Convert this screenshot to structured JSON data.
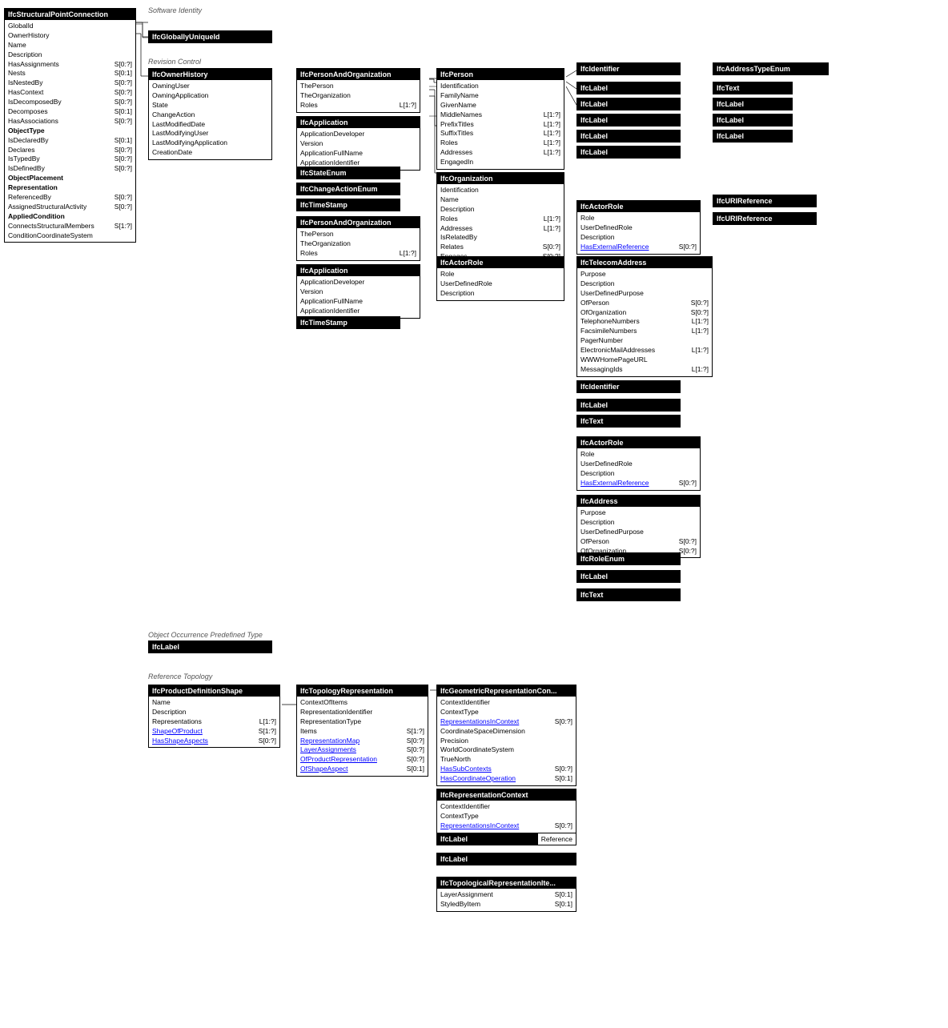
{
  "sections": {
    "softwareIdentity": "Software Identity",
    "revisionControl": "Revision Control",
    "objectOccurrencePredefinedType": "Object Occurrence Predefined Type",
    "referenceTopology": "Reference Topology"
  },
  "boxes": {
    "ifcStructuralPointConnection": {
      "header": "IfcStructuralPointConnection",
      "attrs": [
        {
          "name": "GlobalId",
          "type": ""
        },
        {
          "name": "OwnerHistory",
          "type": ""
        },
        {
          "name": "Name",
          "type": ""
        },
        {
          "name": "Description",
          "type": ""
        },
        {
          "name": "HasAssignments",
          "type": "S[0:?]"
        },
        {
          "name": "Nests",
          "type": "S[0:1]"
        },
        {
          "name": "IsNestedBy",
          "type": "S[0:?]"
        },
        {
          "name": "HasContext",
          "type": "S[0:?]"
        },
        {
          "name": "IsDecomposedBy",
          "type": "S[0:?]"
        },
        {
          "name": "Decomposes",
          "type": "S[0:1]"
        },
        {
          "name": "HasAssociations",
          "type": "S[0:?]"
        },
        {
          "name": "ObjectType",
          "type": "",
          "bold": true
        },
        {
          "name": "IsDeclaredBy",
          "type": "S[0:1]"
        },
        {
          "name": "Declares",
          "type": "S[0:?]"
        },
        {
          "name": "IsTypedBy",
          "type": "S[0:?]"
        },
        {
          "name": "IsDefinedBy",
          "type": "S[0:?]"
        },
        {
          "name": "ObjectPlacement",
          "type": "",
          "bold": true
        },
        {
          "name": "Representation",
          "type": "",
          "bold": true
        },
        {
          "name": "ReferencedBy",
          "type": "S[0:?]"
        },
        {
          "name": "AssignedStructuralActivity",
          "type": "S[0:?]"
        },
        {
          "name": "AppliedCondition",
          "type": "",
          "bold": true
        },
        {
          "name": "ConnectsStructuralMembers",
          "type": "S[1:?]"
        },
        {
          "name": "ConditionCoordinateSystem",
          "type": ""
        }
      ]
    },
    "ifcGloballyUniqueId": {
      "header": "IfcGloballyUniqueId",
      "attrs": []
    },
    "ifcOwnerHistory": {
      "header": "IfcOwnerHistory",
      "attrs": [
        {
          "name": "OwningUser",
          "type": ""
        },
        {
          "name": "OwningApplication",
          "type": ""
        },
        {
          "name": "State",
          "type": ""
        },
        {
          "name": "ChangeAction",
          "type": ""
        },
        {
          "name": "LastModifiedDate",
          "type": ""
        },
        {
          "name": "LastModifyingUser",
          "type": ""
        },
        {
          "name": "LastModifyingApplication",
          "type": ""
        },
        {
          "name": "CreationDate",
          "type": ""
        }
      ]
    },
    "ifcPersonAndOrganization1": {
      "header": "IfcPersonAndOrganization",
      "attrs": [
        {
          "name": "ThePerson",
          "type": ""
        },
        {
          "name": "TheOrganization",
          "type": ""
        },
        {
          "name": "Roles",
          "type": "L[1:?]"
        }
      ]
    },
    "ifcApplication1": {
      "header": "IfcApplication",
      "attrs": [
        {
          "name": "ApplicationDeveloper",
          "type": ""
        },
        {
          "name": "Version",
          "type": ""
        },
        {
          "name": "ApplicationFullName",
          "type": ""
        },
        {
          "name": "ApplicationIdentifier",
          "type": ""
        }
      ]
    },
    "ifcStateEnum": {
      "header": "IfcStateEnum",
      "attrs": []
    },
    "ifcChangeActionEnum": {
      "header": "IfcChangeActionEnum",
      "attrs": []
    },
    "ifcTimeStamp1": {
      "header": "IfcTimeStamp",
      "attrs": []
    },
    "ifcPersonAndOrganization2": {
      "header": "IfcPersonAndOrganization",
      "attrs": [
        {
          "name": "ThePerson",
          "type": ""
        },
        {
          "name": "TheOrganization",
          "type": ""
        },
        {
          "name": "Roles",
          "type": "L[1:?]"
        }
      ]
    },
    "ifcApplication2": {
      "header": "IfcApplication",
      "attrs": [
        {
          "name": "ApplicationDeveloper",
          "type": ""
        },
        {
          "name": "Version",
          "type": ""
        },
        {
          "name": "ApplicationFullName",
          "type": ""
        },
        {
          "name": "ApplicationIdentifier",
          "type": ""
        }
      ]
    },
    "ifcTimeStamp2": {
      "header": "IfcTimeStamp",
      "attrs": []
    },
    "ifcPerson": {
      "header": "IfcPerson",
      "attrs": [
        {
          "name": "Identification",
          "type": ""
        },
        {
          "name": "FamilyName",
          "type": ""
        },
        {
          "name": "GivenName",
          "type": ""
        },
        {
          "name": "MiddleNames",
          "type": "L[1:?]"
        },
        {
          "name": "PrefixTitles",
          "type": "L[1:?]"
        },
        {
          "name": "SuffixTitles",
          "type": "L[1:?]"
        },
        {
          "name": "Roles",
          "type": "L[1:?]"
        },
        {
          "name": "Addresses",
          "type": "L[1:?]"
        },
        {
          "name": "EngagedIn",
          "type": ""
        }
      ]
    },
    "ifcOrganization": {
      "header": "IfcOrganization",
      "attrs": [
        {
          "name": "Identification",
          "type": ""
        },
        {
          "name": "Name",
          "type": ""
        },
        {
          "name": "Description",
          "type": ""
        },
        {
          "name": "Roles",
          "type": "L[1:?]"
        },
        {
          "name": "Addresses",
          "type": "L[1:?]"
        },
        {
          "name": "IsRelatedBy",
          "type": ""
        },
        {
          "name": "Relates",
          "type": "S[0:?]"
        },
        {
          "name": "Engages",
          "type": "S[0:?]"
        }
      ]
    },
    "ifcActorRole1": {
      "header": "IfcActorRole",
      "attrs": [
        {
          "name": "Role",
          "type": ""
        },
        {
          "name": "UserDefinedRole",
          "type": ""
        },
        {
          "name": "Description",
          "type": ""
        }
      ]
    },
    "ifcIdentifier1": {
      "header": "IfcIdentifier",
      "attrs": []
    },
    "ifcLabel1": {
      "header": "IfcLabel",
      "attrs": []
    },
    "ifcLabel2": {
      "header": "IfcLabel",
      "attrs": []
    },
    "ifcLabel3": {
      "header": "IfcLabel",
      "attrs": []
    },
    "ifcLabel4": {
      "header": "IfcLabel",
      "attrs": []
    },
    "ifcLabel5": {
      "header": "IfcLabel",
      "attrs": []
    },
    "ifcActorRole2": {
      "header": "IfcActorRole",
      "attrs": [
        {
          "name": "Role",
          "type": ""
        },
        {
          "name": "UserDefinedRole",
          "type": ""
        },
        {
          "name": "Description",
          "type": ""
        },
        {
          "name": "HasExternalReference",
          "type": "S[0:?]",
          "link": true
        }
      ]
    },
    "ifcTelecomAddress": {
      "header": "IfcTelecomAddress",
      "attrs": [
        {
          "name": "Purpose",
          "type": ""
        },
        {
          "name": "Description",
          "type": ""
        },
        {
          "name": "UserDefinedPurpose",
          "type": ""
        },
        {
          "name": "OfPerson",
          "type": "S[0:?]"
        },
        {
          "name": "OfOrganization",
          "type": "S[0:?]"
        },
        {
          "name": "TelephoneNumbers",
          "type": "L[1:?]"
        },
        {
          "name": "FacsimileNumbers",
          "type": "L[1:?]"
        },
        {
          "name": "PagerNumber",
          "type": ""
        },
        {
          "name": "ElectronicMailAddresses",
          "type": "L[1:?]"
        },
        {
          "name": "WWWHomePageURL",
          "type": ""
        },
        {
          "name": "MessagingIds",
          "type": "L[1:?]"
        }
      ]
    },
    "ifcIdentifier2": {
      "header": "IfcIdentifier",
      "attrs": []
    },
    "ifcLabel6": {
      "header": "IfcLabel",
      "attrs": []
    },
    "ifcText1": {
      "header": "IfcText",
      "attrs": []
    },
    "ifcActorRole3": {
      "header": "IfcActorRole",
      "attrs": [
        {
          "name": "Role",
          "type": ""
        },
        {
          "name": "UserDefinedRole",
          "type": ""
        },
        {
          "name": "Description",
          "type": ""
        },
        {
          "name": "HasExternalReference",
          "type": "S[0:?]",
          "link": true
        }
      ]
    },
    "ifcAddress": {
      "header": "IfcAddress",
      "attrs": [
        {
          "name": "Purpose",
          "type": ""
        },
        {
          "name": "Description",
          "type": ""
        },
        {
          "name": "UserDefinedPurpose",
          "type": ""
        },
        {
          "name": "OfPerson",
          "type": "S[0:?]"
        },
        {
          "name": "OfOrganization",
          "type": "S[0:?]"
        }
      ]
    },
    "ifcRoleEnum": {
      "header": "IfcRoleEnum",
      "attrs": []
    },
    "ifcLabel7": {
      "header": "IfcLabel",
      "attrs": []
    },
    "ifcText2": {
      "header": "IfcText",
      "attrs": []
    },
    "ifcAddressTypeEnum": {
      "header": "IfcAddressTypeEnum",
      "attrs": []
    },
    "ifcText3": {
      "header": "IfcText",
      "attrs": []
    },
    "ifcLabel8": {
      "header": "IfcLabel",
      "attrs": []
    },
    "ifcLabel9": {
      "header": "IfcLabel",
      "attrs": []
    },
    "ifcLabel10": {
      "header": "IfcLabel",
      "attrs": []
    },
    "ifcURIReference1": {
      "header": "IfcURIReference",
      "attrs": []
    },
    "ifcURIReference2": {
      "header": "IfcURIReference",
      "attrs": []
    },
    "ifcLabelOccurrence": {
      "header": "IfcLabel",
      "attrs": []
    },
    "ifcProductDefinitionShape": {
      "header": "IfcProductDefinitionShape",
      "attrs": [
        {
          "name": "Name",
          "type": ""
        },
        {
          "name": "Description",
          "type": ""
        },
        {
          "name": "Representations",
          "type": "L[1:?]"
        },
        {
          "name": "ShapeOfProduct",
          "type": "S[1:?]"
        },
        {
          "name": "HasShapeAspects",
          "type": "S[0:?]"
        }
      ]
    },
    "ifcTopologyRepresentation": {
      "header": "IfcTopologyRepresentation",
      "attrs": [
        {
          "name": "ContextOfItems",
          "type": ""
        },
        {
          "name": "RepresentationIdentifier",
          "type": ""
        },
        {
          "name": "RepresentationType",
          "type": ""
        },
        {
          "name": "Items",
          "type": "S[1:?]"
        },
        {
          "name": "RepresentationMap",
          "type": "S[0:?]"
        },
        {
          "name": "LayerAssignments",
          "type": "S[0:?]"
        },
        {
          "name": "OfProductRepresentation",
          "type": "S[0:?]"
        },
        {
          "name": "OfShapeAspect",
          "type": "S[0:1]"
        }
      ]
    },
    "ifcGeometricRepresentationContext": {
      "header": "IfcGeometricRepresentationCon...",
      "attrs": [
        {
          "name": "ContextIdentifier",
          "type": ""
        },
        {
          "name": "ContextType",
          "type": ""
        },
        {
          "name": "RepresentationsInContext",
          "type": "S[0:?]"
        },
        {
          "name": "CoordinateSpaceDimension",
          "type": ""
        },
        {
          "name": "Precision",
          "type": ""
        },
        {
          "name": "WorldCoordinateSystem",
          "type": ""
        },
        {
          "name": "TrueNorth",
          "type": ""
        },
        {
          "name": "HasSubContexts",
          "type": "S[0:?]"
        },
        {
          "name": "HasCoordinateOperation",
          "type": "S[0:1]"
        }
      ]
    },
    "ifcRepresentationContext": {
      "header": "IfcRepresentationContext",
      "attrs": [
        {
          "name": "ContextIdentifier",
          "type": ""
        },
        {
          "name": "ContextType",
          "type": ""
        },
        {
          "name": "RepresentationsInContext",
          "type": "S[0:?]",
          "link": true
        }
      ]
    },
    "ifcLabelReference": {
      "header": "IfcLabel",
      "suffix": "Reference",
      "attrs": []
    },
    "ifcLabelBottom": {
      "header": "IfcLabel",
      "attrs": []
    },
    "ifcTopologicalRepresentationItem": {
      "header": "IfcTopologicalRepresentationIte...",
      "attrs": [
        {
          "name": "LayerAssignment",
          "type": "S[0:1]"
        },
        {
          "name": "StyledByItem",
          "type": "S[0:1]"
        }
      ]
    }
  }
}
